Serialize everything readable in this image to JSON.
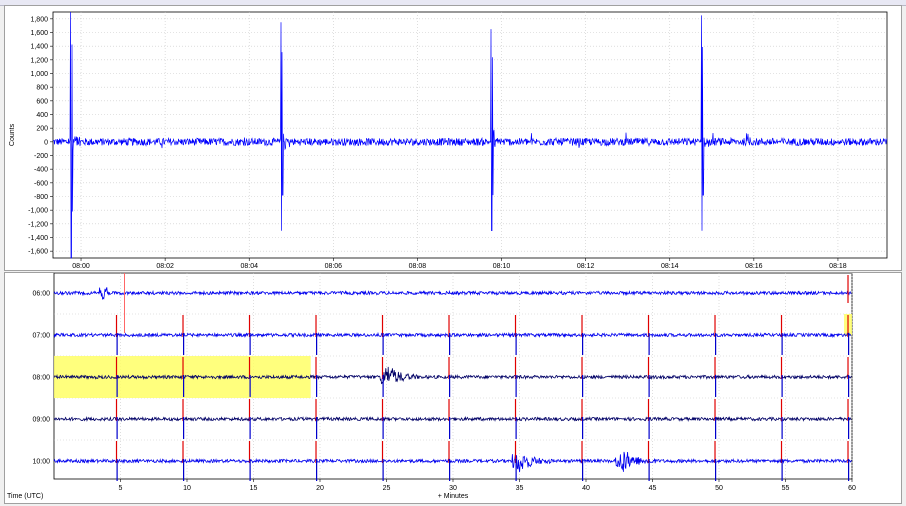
{
  "window": {
    "close_glyph": "×"
  },
  "chart_data": [
    {
      "type": "line",
      "title": "",
      "xlabel": "",
      "ylabel": "Counts",
      "x_ticks": [
        "08:00",
        "08:02",
        "08:04",
        "08:06",
        "08:08",
        "08:10",
        "08:12",
        "08:14",
        "08:16",
        "08:18"
      ],
      "xlim": [
        "07:59:20",
        "08:19:10"
      ],
      "y_ticks": [
        1800,
        1600,
        1400,
        1200,
        1000,
        800,
        600,
        400,
        200,
        0,
        -200,
        -400,
        -600,
        -800,
        -1000,
        -1200,
        -1400,
        -1600
      ],
      "y_tick_labels": [
        "1,800",
        "1,600",
        "1,400",
        "1,200",
        "1,000",
        "800",
        "600",
        "400",
        "200",
        "0",
        "-200",
        "-400",
        "-600",
        "-800",
        "-1,000",
        "-1,200",
        "-1,400",
        "-1,600"
      ],
      "ylim": [
        -1700,
        1900
      ],
      "grid": true,
      "line_color": "#0000ff",
      "series": [
        {
          "values_description": "noise band about 0 counts",
          "spike_events": [
            {
              "time": "07:59:45",
              "max": 1900,
              "min": -1700
            },
            {
              "time": "08:04:45",
              "max": 1750,
              "min": -1300
            },
            {
              "time": "08:09:45",
              "max": 1650,
              "min": -1300
            },
            {
              "time": "08:14:45",
              "max": 1850,
              "min": -1300
            }
          ]
        }
      ]
    },
    {
      "type": "line",
      "title": "",
      "xlabel": "+ Minutes",
      "ylabel": "Time (UTC)",
      "x_ticks": [
        5,
        10,
        15,
        20,
        25,
        30,
        35,
        40,
        45,
        50,
        55,
        60
      ],
      "xlim": [
        0,
        60
      ],
      "grid": true,
      "rows": [
        {
          "label": "06:00",
          "color": "#0000ee",
          "events": []
        },
        {
          "label": "07:00",
          "color": "#0000ee",
          "events": []
        },
        {
          "label": "08:00",
          "color": "#000066",
          "events": [
            24.8
          ]
        },
        {
          "label": "09:00",
          "color": "#000066",
          "events": []
        },
        {
          "label": "10:00",
          "color": "#0000ee",
          "events": [
            34.7,
            42.5
          ]
        }
      ],
      "spike_minutes": [
        4.7,
        9.7,
        14.7,
        19.7,
        24.7,
        29.7,
        34.7,
        39.7,
        44.7,
        49.7,
        54.7,
        59.7
      ],
      "highlights": [
        {
          "row": "08:00",
          "from": 0,
          "to": 19.3,
          "color": "#ffff66"
        },
        {
          "row": "07:00",
          "from": 59.4,
          "to": 60,
          "color": "#ffff66"
        }
      ],
      "marker_minute": 5.3,
      "marker_color": "#ff6666"
    }
  ]
}
